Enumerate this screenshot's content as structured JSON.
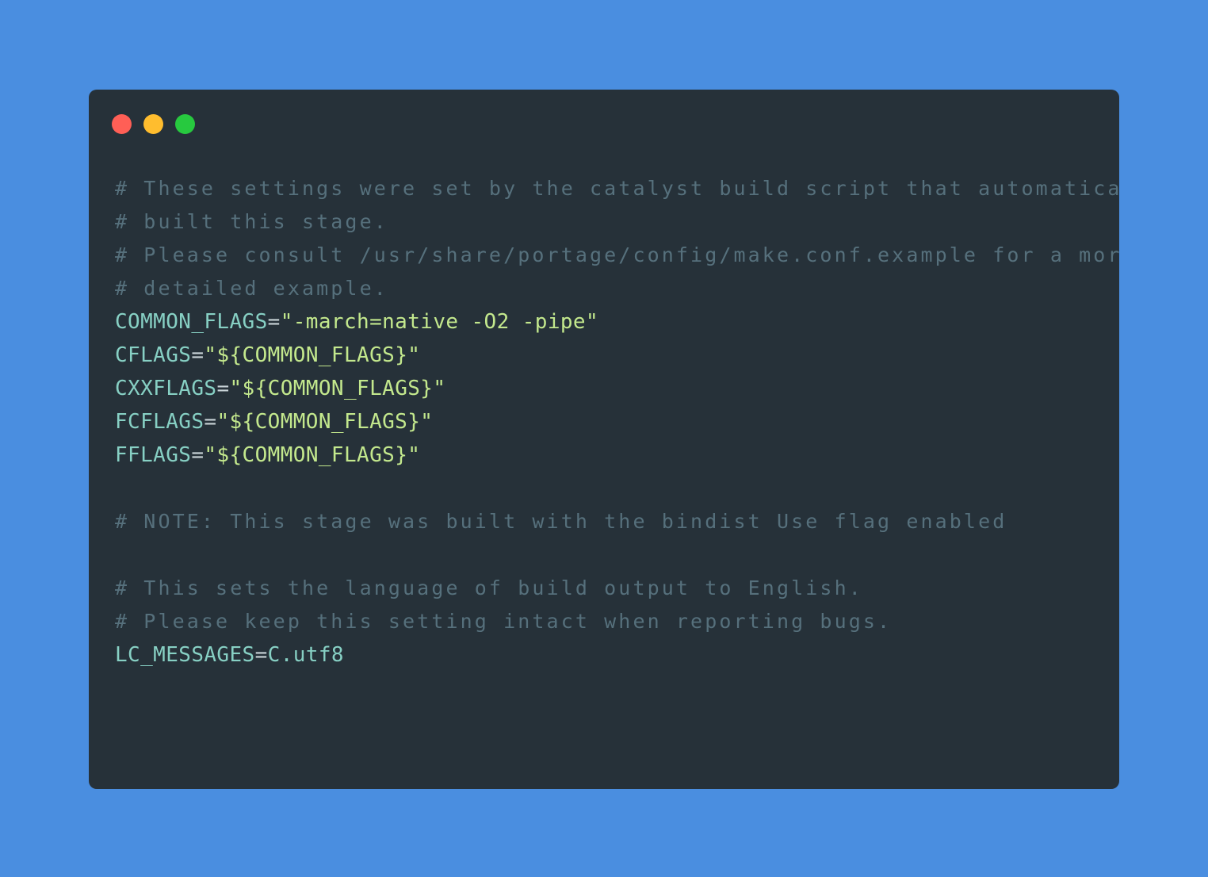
{
  "window": {
    "controls": [
      {
        "name": "close-dot",
        "color": "#ff5f56"
      },
      {
        "name": "minimize-dot",
        "color": "#ffbd2e"
      },
      {
        "name": "maximize-dot",
        "color": "#27c93f"
      }
    ]
  },
  "code": {
    "lines": [
      {
        "type": "comment",
        "text": "# These settings were set by the catalyst build script that automatically"
      },
      {
        "type": "comment",
        "text": "# built this stage."
      },
      {
        "type": "comment",
        "text": "# Please consult /usr/share/portage/config/make.conf.example for a more"
      },
      {
        "type": "comment",
        "text": "# detailed example."
      },
      {
        "type": "assign",
        "key": "COMMON_FLAGS",
        "eq": "=",
        "value": "\"-march=native -O2 -pipe\"",
        "value_kind": "string"
      },
      {
        "type": "assign",
        "key": "CFLAGS",
        "eq": "=",
        "value": "\"${COMMON_FLAGS}\"",
        "value_kind": "string"
      },
      {
        "type": "assign",
        "key": "CXXFLAGS",
        "eq": "=",
        "value": "\"${COMMON_FLAGS}\"",
        "value_kind": "string"
      },
      {
        "type": "assign",
        "key": "FCFLAGS",
        "eq": "=",
        "value": "\"${COMMON_FLAGS}\"",
        "value_kind": "string"
      },
      {
        "type": "assign",
        "key": "FFLAGS",
        "eq": "=",
        "value": "\"${COMMON_FLAGS}\"",
        "value_kind": "string"
      },
      {
        "type": "blank"
      },
      {
        "type": "comment",
        "text": "# NOTE: This stage was built with the bindist Use flag enabled"
      },
      {
        "type": "blank"
      },
      {
        "type": "comment",
        "text": "# This sets the language of build output to English."
      },
      {
        "type": "comment",
        "text": "# Please keep this setting intact when reporting bugs."
      },
      {
        "type": "assign",
        "key": "LC_MESSAGES",
        "eq": "=",
        "value": "C.utf8",
        "value_kind": "plain"
      }
    ]
  }
}
